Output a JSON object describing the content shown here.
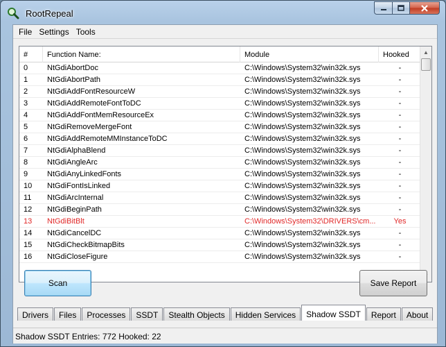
{
  "window": {
    "title": "RootRepeal"
  },
  "menu": [
    "File",
    "Settings",
    "Tools"
  ],
  "table": {
    "headers": [
      "#",
      "Function Name:",
      "Module",
      "Hooked"
    ],
    "rows": [
      {
        "num": "0",
        "name": "NtGdiAbortDoc",
        "module": "C:\\Windows\\System32\\win32k.sys",
        "hooked": "-"
      },
      {
        "num": "1",
        "name": "NtGdiAbortPath",
        "module": "C:\\Windows\\System32\\win32k.sys",
        "hooked": "-"
      },
      {
        "num": "2",
        "name": "NtGdiAddFontResourceW",
        "module": "C:\\Windows\\System32\\win32k.sys",
        "hooked": "-"
      },
      {
        "num": "3",
        "name": "NtGdiAddRemoteFontToDC",
        "module": "C:\\Windows\\System32\\win32k.sys",
        "hooked": "-"
      },
      {
        "num": "4",
        "name": "NtGdiAddFontMemResourceEx",
        "module": "C:\\Windows\\System32\\win32k.sys",
        "hooked": "-"
      },
      {
        "num": "5",
        "name": "NtGdiRemoveMergeFont",
        "module": "C:\\Windows\\System32\\win32k.sys",
        "hooked": "-"
      },
      {
        "num": "6",
        "name": "NtGdiAddRemoteMMInstanceToDC",
        "module": "C:\\Windows\\System32\\win32k.sys",
        "hooked": "-"
      },
      {
        "num": "7",
        "name": "NtGdiAlphaBlend",
        "module": "C:\\Windows\\System32\\win32k.sys",
        "hooked": "-"
      },
      {
        "num": "8",
        "name": "NtGdiAngleArc",
        "module": "C:\\Windows\\System32\\win32k.sys",
        "hooked": "-"
      },
      {
        "num": "9",
        "name": "NtGdiAnyLinkedFonts",
        "module": "C:\\Windows\\System32\\win32k.sys",
        "hooked": "-"
      },
      {
        "num": "10",
        "name": "NtGdiFontIsLinked",
        "module": "C:\\Windows\\System32\\win32k.sys",
        "hooked": "-"
      },
      {
        "num": "11",
        "name": "NtGdiArcInternal",
        "module": "C:\\Windows\\System32\\win32k.sys",
        "hooked": "-"
      },
      {
        "num": "12",
        "name": "NtGdiBeginPath",
        "module": "C:\\Windows\\System32\\win32k.sys",
        "hooked": "-"
      },
      {
        "num": "13",
        "name": "NtGdiBitBlt",
        "module": "C:\\Windows\\System32\\DRIVERS\\cm...",
        "hooked": "Yes"
      },
      {
        "num": "14",
        "name": "NtGdiCancelDC",
        "module": "C:\\Windows\\System32\\win32k.sys",
        "hooked": "-"
      },
      {
        "num": "15",
        "name": "NtGdiCheckBitmapBits",
        "module": "C:\\Windows\\System32\\win32k.sys",
        "hooked": "-"
      },
      {
        "num": "16",
        "name": "NtGdiCloseFigure",
        "module": "C:\\Windows\\System32\\win32k.sys",
        "hooked": "-"
      }
    ]
  },
  "buttons": {
    "scan": "Scan",
    "save_report": "Save Report"
  },
  "tabs": [
    "Drivers",
    "Files",
    "Processes",
    "SSDT",
    "Stealth Objects",
    "Hidden Services",
    "Shadow SSDT",
    "Report",
    "About"
  ],
  "active_tab": "Shadow SSDT",
  "status": "Shadow SSDT Entries: 772   Hooked: 22",
  "colors": {
    "hooked_row": "#e02828",
    "accent": "#3c7fb1"
  },
  "icons": {
    "app": "magnifier-icon"
  }
}
